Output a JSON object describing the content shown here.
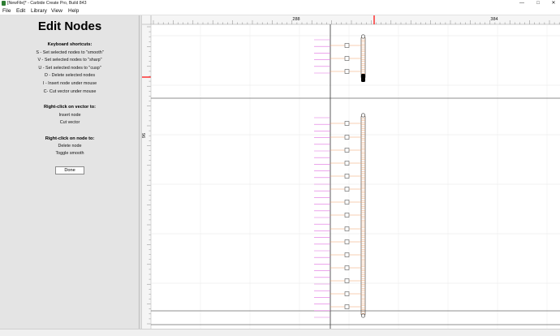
{
  "window": {
    "title": "[NewFile]* - Carbide Create Pro, Build 843",
    "minimize_glyph": "—",
    "maximize_glyph": "□",
    "close_glyph": "✕"
  },
  "menu": [
    "File",
    "Edit",
    "Library",
    "View",
    "Help"
  ],
  "panel": {
    "title": "Edit Nodes",
    "keyboard_heading": "Keyboard shortcuts:",
    "shortcuts": [
      "S - Set selected nodes to \"smooth\"",
      "V - Set selected nodes to \"sharp\"",
      "U - Set selected nodes to \"cusp\"",
      "D - Delete selected nodes",
      "I - Insert node under mouse",
      "C- Cut vector under mouse"
    ],
    "vector_heading": "Right-click on vector to:",
    "vector_actions": [
      "Insert node",
      "Cut vector"
    ],
    "node_heading": "Right-click on node to:",
    "node_actions": [
      "Delete node",
      "Toggle smooth"
    ],
    "done_label": "Done"
  },
  "ruler": {
    "top_labels": [
      "288",
      "384"
    ],
    "left_label": "96"
  },
  "colors": {
    "panel_bg": "#e4e4e4",
    "ruler_marker": "#ff0000",
    "handle_orange": "#f0a068",
    "handle_magenta": "#e070e0",
    "node_black": "#000000"
  }
}
